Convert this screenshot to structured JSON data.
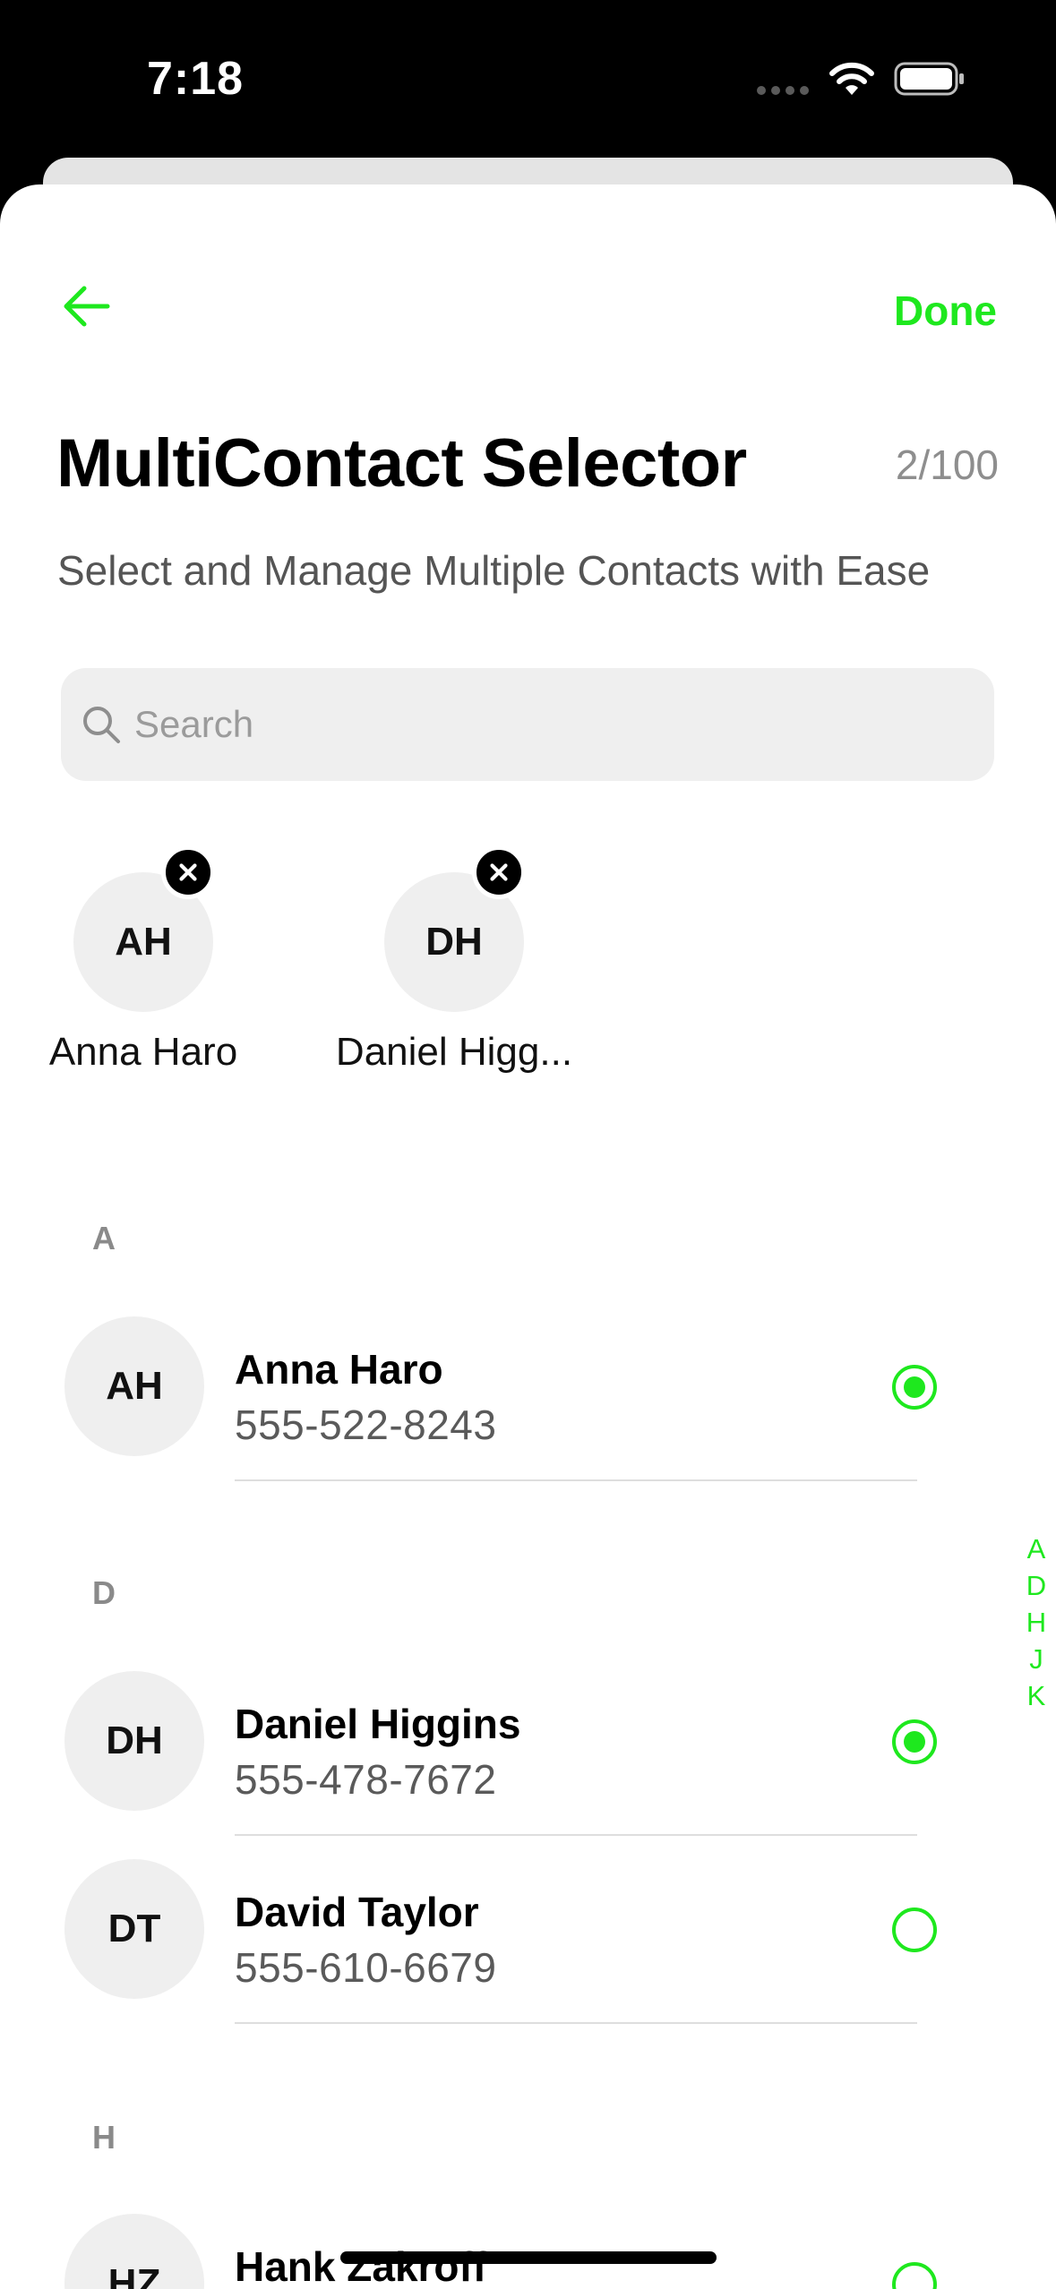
{
  "status_bar": {
    "time": "7:18"
  },
  "header": {
    "done_label": "Done",
    "title": "MultiContact Selector",
    "counter": "2/100",
    "subtitle": "Select and Manage Multiple Contacts with Ease"
  },
  "search": {
    "placeholder": "Search",
    "value": ""
  },
  "selected_chips": [
    {
      "initials": "AH",
      "name": "Anna Haro"
    },
    {
      "initials": "DH",
      "name": "Daniel Higg..."
    }
  ],
  "sections": [
    {
      "letter": "A",
      "contacts": [
        {
          "initials": "AH",
          "name": "Anna Haro",
          "phone": "555-522-8243",
          "selected": true
        }
      ]
    },
    {
      "letter": "D",
      "contacts": [
        {
          "initials": "DH",
          "name": "Daniel Higgins",
          "phone": "555-478-7672",
          "selected": true
        },
        {
          "initials": "DT",
          "name": "David Taylor",
          "phone": "555-610-6679",
          "selected": false
        }
      ]
    },
    {
      "letter": "H",
      "contacts": [
        {
          "initials": "HZ",
          "name": "Hank Zakroff",
          "phone": "",
          "selected": false
        }
      ]
    }
  ],
  "index_letters": [
    "A",
    "D",
    "H",
    "J",
    "K"
  ],
  "colors": {
    "accent": "#1ee81e",
    "avatar_bg": "#efefef",
    "section_header": "#8a8a8a"
  },
  "icons": {
    "back": "arrow-left-icon",
    "search": "magnifier-icon",
    "remove": "close-icon",
    "radio_on": "radio-selected-icon",
    "radio_off": "radio-unselected-icon"
  }
}
